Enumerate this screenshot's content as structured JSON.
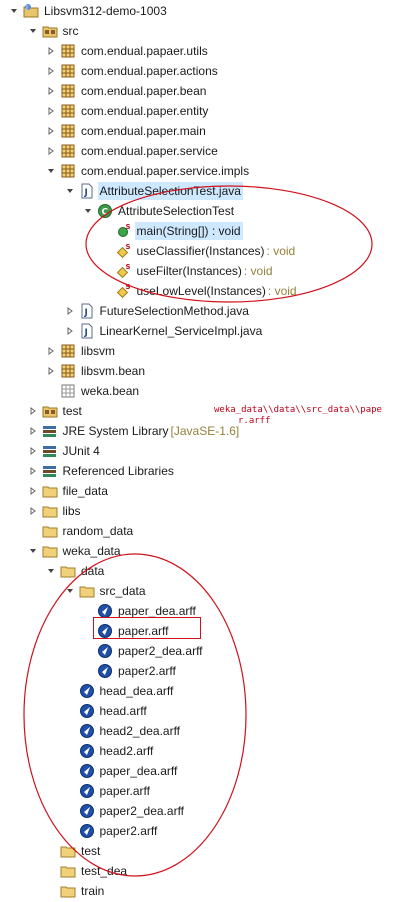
{
  "tree": [
    {
      "label": "Libsvm312-demo-1003",
      "icon": "java-project-icon",
      "depth": 0,
      "twisty": "open"
    },
    {
      "label": "src",
      "icon": "source-folder-icon",
      "depth": 1,
      "twisty": "open"
    },
    {
      "label": "com.endual.papaer.utils",
      "icon": "package-icon",
      "depth": 2,
      "twisty": "closed"
    },
    {
      "label": "com.endual.paper.actions",
      "icon": "package-icon",
      "depth": 2,
      "twisty": "closed"
    },
    {
      "label": "com.endual.paper.bean",
      "icon": "package-icon",
      "depth": 2,
      "twisty": "closed"
    },
    {
      "label": "com.endual.paper.entity",
      "icon": "package-icon",
      "depth": 2,
      "twisty": "closed"
    },
    {
      "label": "com.endual.paper.main",
      "icon": "package-icon",
      "depth": 2,
      "twisty": "closed"
    },
    {
      "label": "com.endual.paper.service",
      "icon": "package-icon",
      "depth": 2,
      "twisty": "closed"
    },
    {
      "label": "com.endual.paper.service.impls",
      "icon": "package-icon",
      "depth": 2,
      "twisty": "open"
    },
    {
      "label": "AttributeSelectionTest.java",
      "icon": "java-file-icon",
      "depth": 3,
      "twisty": "open",
      "selected": true
    },
    {
      "label": "AttributeSelectionTest",
      "icon": "class-icon",
      "depth": 4,
      "twisty": "open"
    },
    {
      "label": "main(String[]) : void",
      "icon": "public-static-method-icon",
      "depth": 5,
      "twisty": "none",
      "selected": true
    },
    {
      "label": "useClassifier(Instances)",
      "suffix": " : void",
      "icon": "private-static-method-icon",
      "depth": 5,
      "twisty": "none"
    },
    {
      "label": "useFilter(Instances)",
      "suffix": " : void",
      "icon": "private-static-method-icon",
      "depth": 5,
      "twisty": "none"
    },
    {
      "label": "useLowLevel(Instances)",
      "suffix": " : void",
      "icon": "private-static-method-icon",
      "depth": 5,
      "twisty": "none"
    },
    {
      "label": "FutureSelectionMethod.java",
      "icon": "java-file-icon",
      "depth": 3,
      "twisty": "closed"
    },
    {
      "label": "LinearKernel_ServiceImpl.java",
      "icon": "java-file-icon",
      "depth": 3,
      "twisty": "closed"
    },
    {
      "label": "libsvm",
      "icon": "package-icon",
      "depth": 2,
      "twisty": "closed"
    },
    {
      "label": "libsvm.bean",
      "icon": "package-icon",
      "depth": 2,
      "twisty": "closed"
    },
    {
      "label": "weka.bean",
      "icon": "empty-package-icon",
      "depth": 2,
      "twisty": "none"
    },
    {
      "label": "test",
      "icon": "source-folder-icon",
      "depth": 1,
      "twisty": "closed"
    },
    {
      "label": "JRE System Library",
      "suffix": " [JavaSE-1.6]",
      "icon": "library-icon",
      "depth": 1,
      "twisty": "closed"
    },
    {
      "label": "JUnit 4",
      "icon": "library-icon",
      "depth": 1,
      "twisty": "closed"
    },
    {
      "label": "Referenced Libraries",
      "icon": "library-icon",
      "depth": 1,
      "twisty": "closed"
    },
    {
      "label": "file_data",
      "icon": "folder-icon",
      "depth": 1,
      "twisty": "closed"
    },
    {
      "label": "libs",
      "icon": "folder-icon",
      "depth": 1,
      "twisty": "closed"
    },
    {
      "label": "random_data",
      "icon": "folder-icon",
      "depth": 1,
      "twisty": "none"
    },
    {
      "label": "weka_data",
      "icon": "folder-icon",
      "depth": 1,
      "twisty": "open"
    },
    {
      "label": "data",
      "icon": "folder-icon",
      "depth": 2,
      "twisty": "open"
    },
    {
      "label": "src_data",
      "icon": "folder-icon",
      "depth": 3,
      "twisty": "open"
    },
    {
      "label": "paper_dea.arff",
      "icon": "weka-file-icon",
      "depth": 4,
      "twisty": "none"
    },
    {
      "label": "paper.arff",
      "icon": "weka-file-icon",
      "depth": 4,
      "twisty": "none"
    },
    {
      "label": "paper2_dea.arff",
      "icon": "weka-file-icon",
      "depth": 4,
      "twisty": "none"
    },
    {
      "label": "paper2.arff",
      "icon": "weka-file-icon",
      "depth": 4,
      "twisty": "none"
    },
    {
      "label": "head_dea.arff",
      "icon": "weka-file-icon",
      "depth": 3,
      "twisty": "none"
    },
    {
      "label": "head.arff",
      "icon": "weka-file-icon",
      "depth": 3,
      "twisty": "none"
    },
    {
      "label": "head2_dea.arff",
      "icon": "weka-file-icon",
      "depth": 3,
      "twisty": "none"
    },
    {
      "label": "head2.arff",
      "icon": "weka-file-icon",
      "depth": 3,
      "twisty": "none"
    },
    {
      "label": "paper_dea.arff",
      "icon": "weka-file-icon",
      "depth": 3,
      "twisty": "none"
    },
    {
      "label": "paper.arff",
      "icon": "weka-file-icon",
      "depth": 3,
      "twisty": "none"
    },
    {
      "label": "paper2_dea.arff",
      "icon": "weka-file-icon",
      "depth": 3,
      "twisty": "none"
    },
    {
      "label": "paper2.arff",
      "icon": "weka-file-icon",
      "depth": 3,
      "twisty": "none"
    },
    {
      "label": "test",
      "icon": "folder-icon",
      "depth": 2,
      "twisty": "none"
    },
    {
      "label": "test_dea",
      "icon": "folder-icon",
      "depth": 2,
      "twisty": "none"
    },
    {
      "label": "train",
      "icon": "folder-icon",
      "depth": 2,
      "twisty": "none"
    }
  ],
  "annotation": {
    "path_note": "weka_data\\\\data\\\\src_data\\\\paper.arff",
    "path_note_line1": "weka_data\\\\data\\\\src_data\\\\pape",
    "path_note_line2": "r.arff"
  },
  "colors": {
    "annotation": "#d0101a",
    "selection": "#cde8ff",
    "decoration_text": "#95803c"
  }
}
